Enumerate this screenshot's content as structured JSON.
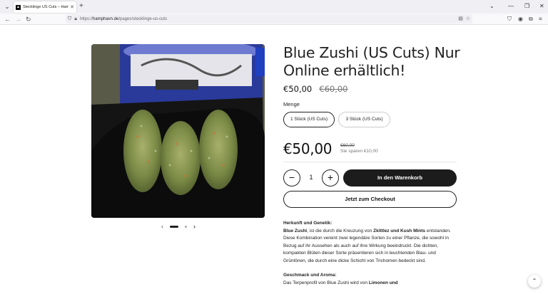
{
  "browser": {
    "tab_title": "Stecklinge US Cuts – Hamphavn",
    "tab_close": "✕",
    "new_tab": "+",
    "url_prefix": "https://",
    "url_host": "hamphavn.de",
    "url_path": "/pages/stecklinge-us-cuts"
  },
  "product": {
    "title": "Blue Zushi (US Cuts) Nur Online erhältlich!",
    "price": "€50,00",
    "compare_price": "€60,00",
    "quantity_label": "Menge",
    "variants": [
      "1 Stück (US Cuts)",
      "3 Stück (US Cuts)"
    ],
    "big_price": "€50,00",
    "big_compare_price": "€60,00",
    "saving_text": "Sie sparen €10,00",
    "qty_minus": "−",
    "qty_plus": "+",
    "qty_value": "1",
    "add_to_cart": "In den Warenkorb",
    "checkout": "Jetzt zum Checkout"
  },
  "gallery": {
    "prev": "‹",
    "next": "›",
    "image_slide_index": 1,
    "image_slide_count": 2
  },
  "description": {
    "origin_heading": "Herkunft und Genetik:",
    "origin_strong1": "Blue Zushi",
    "origin_t1": ", ist die durch die Kreuzung von ",
    "origin_strong2": "Zkittlez und Kush Mints",
    "origin_t2": " entstanden. Diese Kombination vereint zwei legendäre Sorten zu einer Pflanze, die sowohl in Bezug auf ihr Aussehen als auch auf ihre Wirkung beeindruckt. Die dichten, kompakten Blüten dieser Sorte präsentieren sich in leuchtenden Blau- und Grüntönen, die durch eine dicke Schicht von Trichomen bedeckt sind.",
    "taste_heading": "Geschmack und Aroma:",
    "taste_t1": "Das Terpenprofil von Blue Zushi wird von ",
    "taste_strong1": "Limonen und"
  },
  "colors": {
    "accent": "#1c1c1c",
    "text": "#222222",
    "muted": "#777777"
  }
}
